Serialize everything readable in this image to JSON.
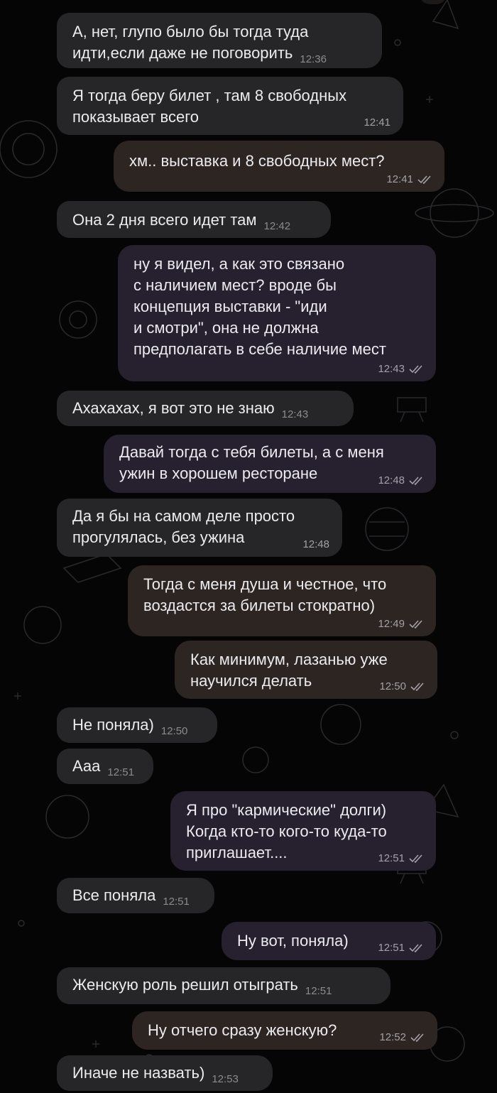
{
  "conversation": {
    "messages": [
      {
        "text": "А, нет, глупо было бы тогда туда\nидти,если даже не поговорить",
        "time": "12:36"
      },
      {
        "text": "Я тогда беру билет , там 8 свободных\nпоказывает всего",
        "time": "12:41"
      },
      {
        "text": "хм.. выставка и 8 свободных мест?",
        "time": "12:41"
      },
      {
        "text": "Она 2 дня всего идет там",
        "time": "12:42"
      },
      {
        "text": "ну я видел, а как это связано\nс наличием мест? вроде бы\nконцепция выставки - \"иди\nи смотри\", она не должна\nпредполагать в себе наличие мест",
        "time": "12:43"
      },
      {
        "text": "Ахахахах, я вот это не знаю",
        "time": "12:43"
      },
      {
        "text": "Давай тогда с тебя билеты, а с меня\nужин в хорошем ресторане",
        "time": "12:48"
      },
      {
        "text": "Да я бы на самом деле просто\nпрогулялась, без ужина",
        "time": "12:48"
      },
      {
        "text": "Тогда с меня душа и честное, что\nвоздастся за билеты стократно)",
        "time": "12:49"
      },
      {
        "text": "Как минимум, лазанью уже\nнаучился делать",
        "time": "12:50"
      },
      {
        "text": "Не поняла)",
        "time": "12:50"
      },
      {
        "text": "Ааа",
        "time": "12:51"
      },
      {
        "text": "Я про \"кармические\" долги)\nКогда кто-то кого-то куда-то\nприглашает....",
        "time": "12:51"
      },
      {
        "text": "Все поняла",
        "time": "12:51"
      },
      {
        "text": "Ну вот, поняла)",
        "time": "12:51"
      },
      {
        "text": "Женскую роль решил отыграть",
        "time": "12:51"
      },
      {
        "text": "Ну отчего сразу женскую?",
        "time": "12:52"
      },
      {
        "text": "Иначе не назвать)",
        "time": "12:53"
      }
    ]
  },
  "icons": {
    "read_receipt": "double-check-icon"
  },
  "colors": {
    "background": "#050506",
    "incoming_bubble": "#262628",
    "outgoing_bubble_brown": "#2c2521",
    "outgoing_bubble_purple": "#27202f",
    "text": "#ecebef",
    "timestamp": "#8c8a90"
  }
}
